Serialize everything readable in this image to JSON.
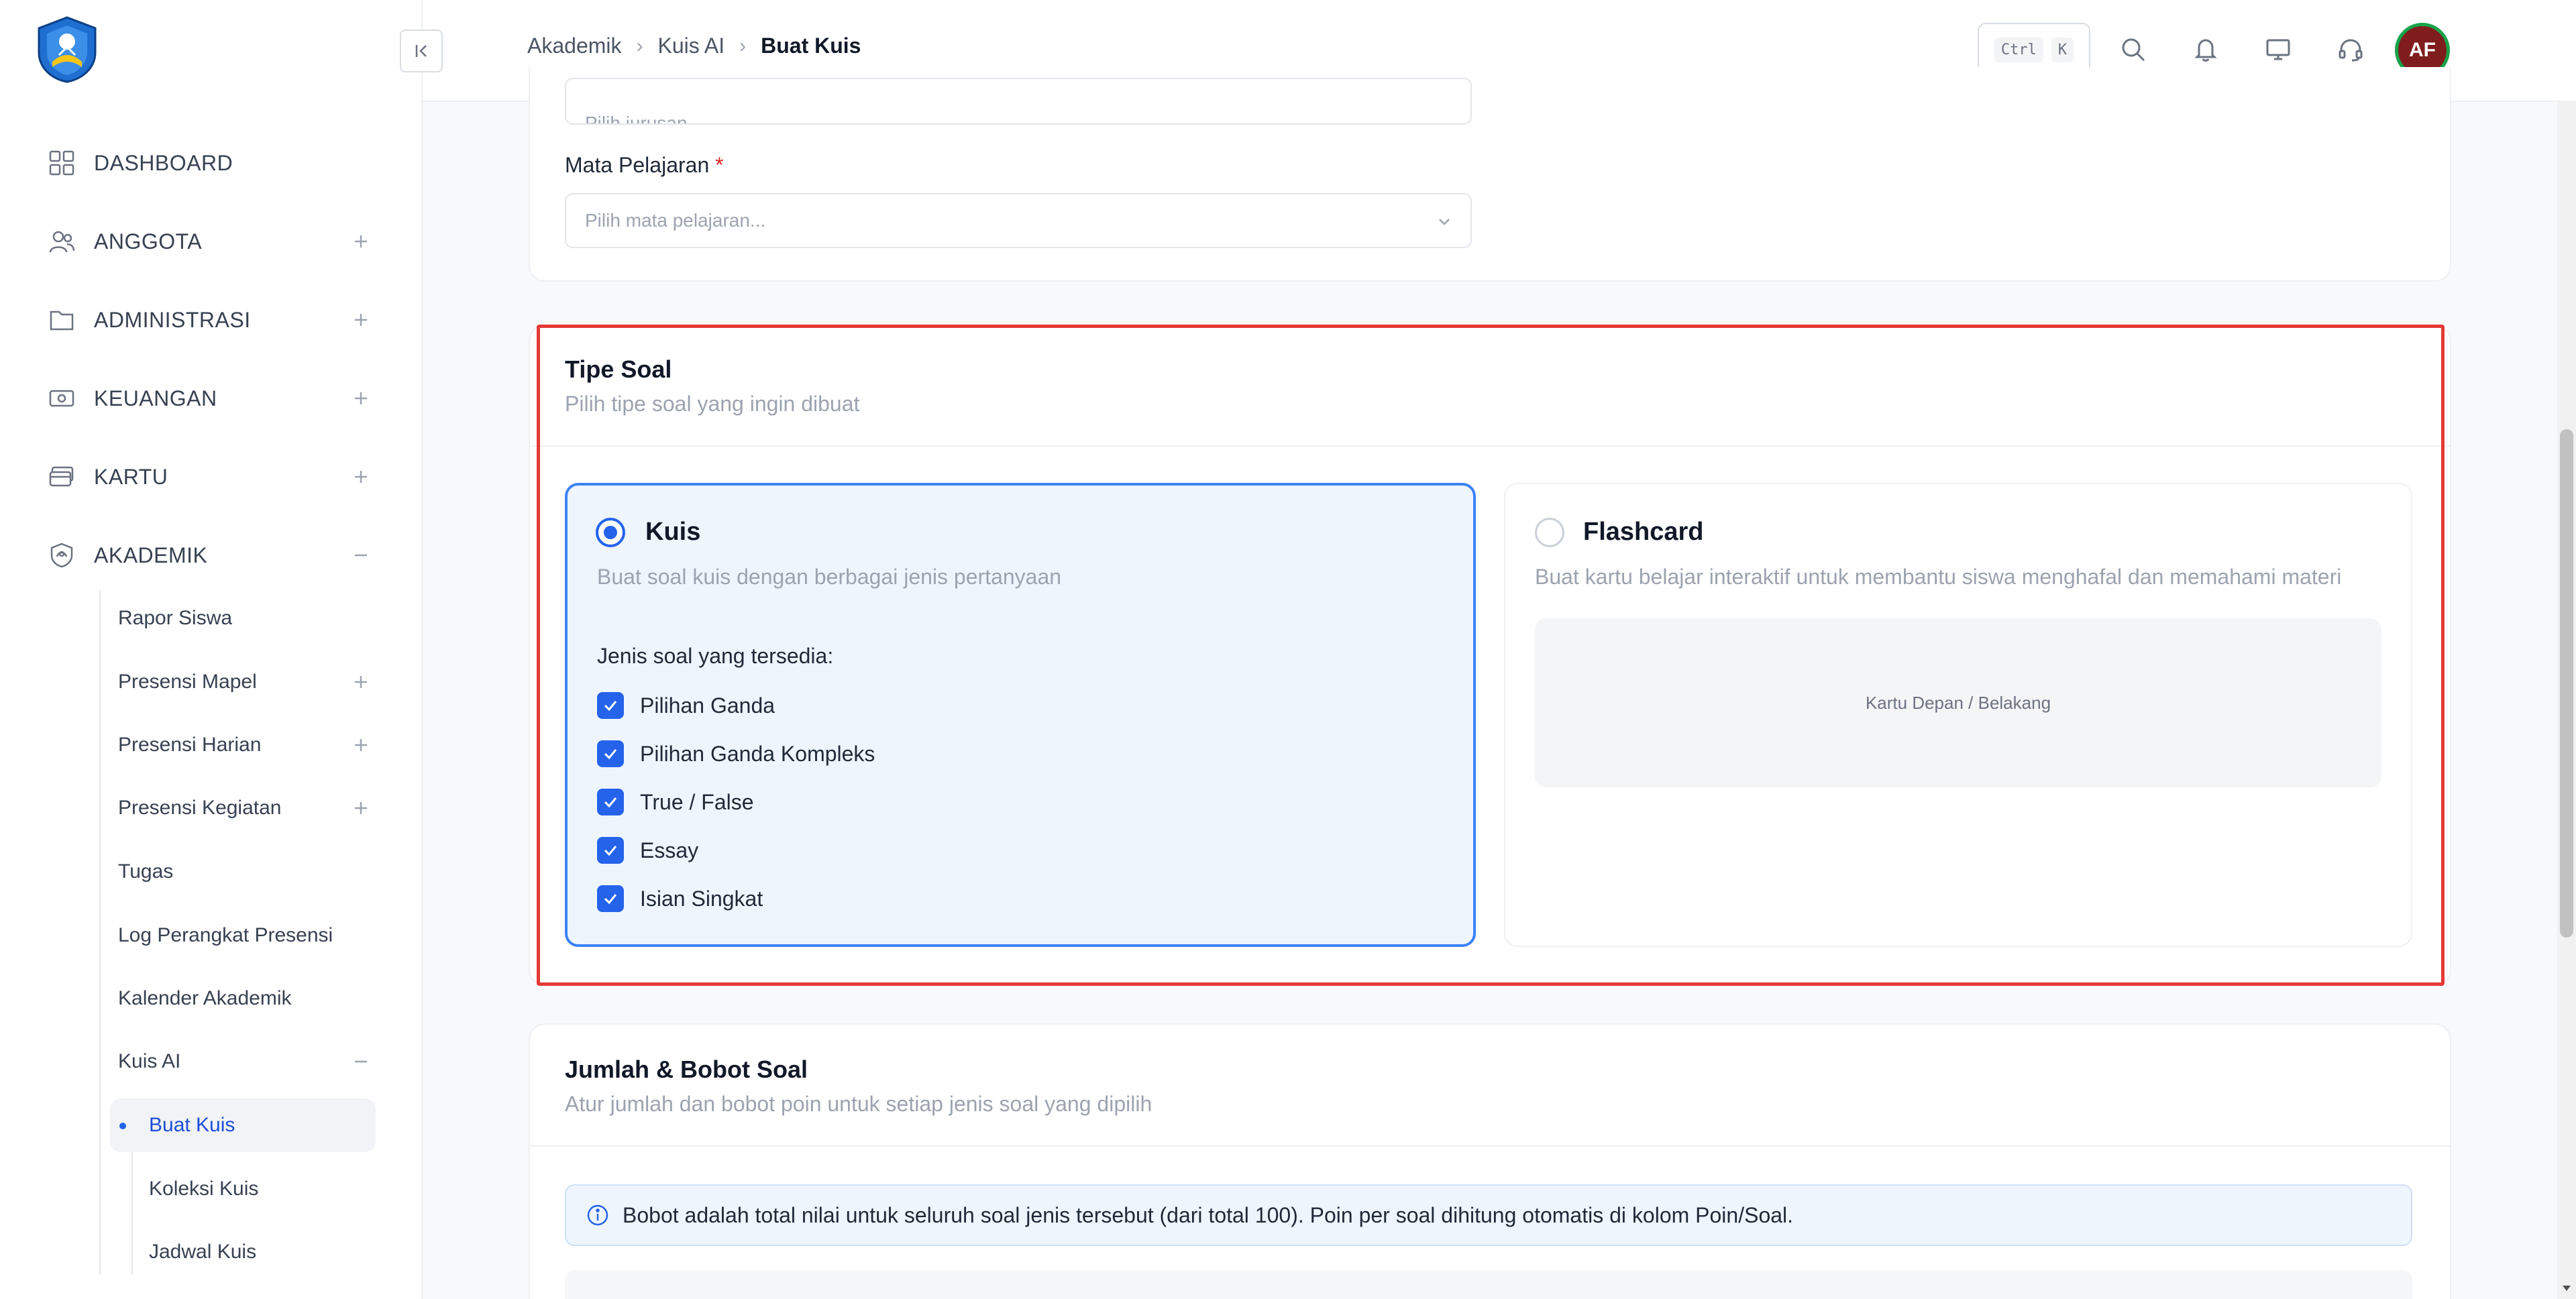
{
  "colors": {
    "accent": "#2563eb",
    "highlight": "#e53935",
    "avatar_bg": "#7f1d1d",
    "avatar_ring": "#16a34a"
  },
  "sidebar": {
    "items": [
      {
        "label": "DASHBOARD",
        "icon": "grid-icon"
      },
      {
        "label": "ANGGOTA",
        "icon": "users-icon",
        "toggle": "+"
      },
      {
        "label": "ADMINISTRASI",
        "icon": "folder-icon",
        "toggle": "+"
      },
      {
        "label": "KEUANGAN",
        "icon": "money-icon",
        "toggle": "+"
      },
      {
        "label": "KARTU",
        "icon": "card-icon",
        "toggle": "+"
      },
      {
        "label": "AKADEMIK",
        "icon": "academic-icon",
        "toggle": "−"
      }
    ],
    "akademik_sub": [
      {
        "label": "Rapor Siswa"
      },
      {
        "label": "Presensi Mapel",
        "toggle": "+"
      },
      {
        "label": "Presensi Harian",
        "toggle": "+"
      },
      {
        "label": "Presensi Kegiatan",
        "toggle": "+"
      },
      {
        "label": "Tugas"
      },
      {
        "label": "Log Perangkat Presensi"
      },
      {
        "label": "Kalender Akademik"
      },
      {
        "label": "Kuis AI",
        "toggle": "−"
      }
    ],
    "kuis_sub": [
      {
        "label": "Buat Kuis",
        "active": true
      },
      {
        "label": "Koleksi Kuis"
      },
      {
        "label": "Jadwal Kuis"
      }
    ]
  },
  "header": {
    "breadcrumb": [
      "Akademik",
      "Kuis AI",
      "Buat Kuis"
    ],
    "shortcut": [
      "Ctrl",
      "K"
    ],
    "avatar_initials": "AF",
    "icons": [
      "search-icon",
      "bell-icon",
      "monitor-icon",
      "headset-icon"
    ]
  },
  "form": {
    "jurusan_placeholder": "Pilih jurusan...",
    "mapel_label": "Mata Pelajaran",
    "required_mark": "*",
    "mapel_placeholder": "Pilih mata pelajaran..."
  },
  "tipe_soal": {
    "title": "Tipe Soal",
    "subtitle": "Pilih tipe soal yang ingin dibuat",
    "kuis": {
      "title": "Kuis",
      "desc": "Buat soal kuis dengan berbagai jenis pertanyaan",
      "selected": true,
      "types_label": "Jenis soal yang tersedia:",
      "types": [
        "Pilihan Ganda",
        "Pilihan Ganda Kompleks",
        "True / False",
        "Essay",
        "Isian Singkat"
      ]
    },
    "flashcard": {
      "title": "Flashcard",
      "desc": "Buat kartu belajar interaktif untuk membantu siswa menghafal dan memahami materi",
      "selected": false,
      "preview": "Kartu Depan / Belakang"
    }
  },
  "jumlah": {
    "title": "Jumlah & Bobot Soal",
    "subtitle": "Atur jumlah dan bobot poin untuk setiap jenis soal yang dipilih",
    "info": "Bobot adalah total nilai untuk seluruh soal jenis tersebut (dari total 100). Poin per soal dihitung otomatis di kolom Poin/Soal."
  }
}
